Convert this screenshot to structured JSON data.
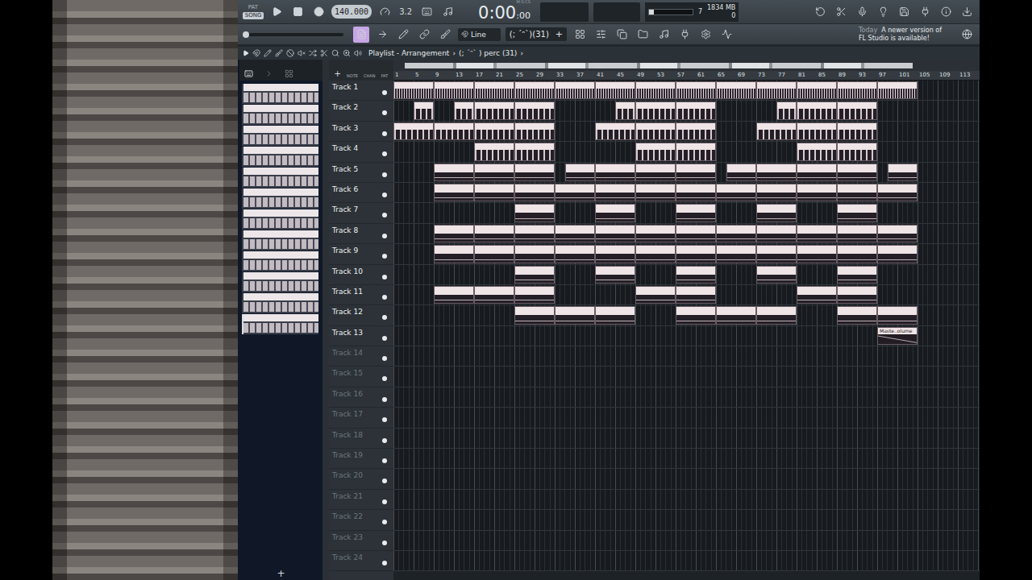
{
  "transport": {
    "modes": [
      {
        "label": "PAT",
        "selected": false
      },
      {
        "label": "SONG",
        "selected": true
      }
    ],
    "tempo": "140.000",
    "step": "3.2",
    "time": "0:00",
    "time_cs": ":00",
    "time_format": "M:S:CS"
  },
  "monitor": {
    "cpu": "7",
    "memory": "1834 MB",
    "polyphony": "0",
    "cpu_level": 0.12
  },
  "master_pitch": {
    "level": 0
  },
  "tools": [
    {
      "selected": true
    },
    {
      "selected": false
    },
    {
      "selected": false
    },
    {
      "selected": false
    },
    {
      "selected": false
    }
  ],
  "snap": "Line",
  "pattern_picker": {
    "label": "(; ´ᵔ`)(31)",
    "add": "+"
  },
  "hint": {
    "date": "Today",
    "line1": "A newer version of",
    "line2": "FL Studio is available!"
  },
  "browser": {
    "patterns": [
      {
        "selected": false
      },
      {
        "selected": false
      },
      {
        "selected": false
      },
      {
        "selected": false
      },
      {
        "selected": false
      },
      {
        "selected": false
      },
      {
        "selected": false
      },
      {
        "selected": false
      },
      {
        "selected": false
      },
      {
        "selected": false
      },
      {
        "selected": false
      },
      {
        "selected": true
      }
    ],
    "add": "+"
  },
  "playlist": {
    "title": "Playlist - Arrangement",
    "separator": "›",
    "pattern": "(; ´ᵔ` ) perc (31)",
    "header_tabs": [
      "NOTE",
      "CHAN",
      "PAT"
    ],
    "add": "+",
    "ruler": [
      "1",
      "5",
      "9",
      "13",
      "17",
      "21",
      "25",
      "29",
      "33",
      "37",
      "41",
      "45",
      "49",
      "53",
      "57",
      "61",
      "65",
      "69",
      "73",
      "77",
      "81",
      "85",
      "89",
      "93",
      "97",
      "101",
      "105",
      "109",
      "113"
    ],
    "tracks": [
      {
        "name": "Track 1",
        "dimmed": false,
        "kind": "dense",
        "clips": [
          {
            "start": 1,
            "length": 8
          },
          {
            "start": 9,
            "length": 8
          },
          {
            "start": 17,
            "length": 8
          },
          {
            "start": 25,
            "length": 8
          },
          {
            "start": 33,
            "length": 8
          },
          {
            "start": 41,
            "length": 8
          },
          {
            "start": 49,
            "length": 8
          },
          {
            "start": 57,
            "length": 8
          },
          {
            "start": 65,
            "length": 8
          },
          {
            "start": 73,
            "length": 8
          },
          {
            "start": 81,
            "length": 8
          },
          {
            "start": 89,
            "length": 8
          },
          {
            "start": 97,
            "length": 8
          }
        ]
      },
      {
        "name": "Track 2",
        "dimmed": false,
        "kind": "notes",
        "clips": [
          {
            "start": 5,
            "length": 4
          },
          {
            "start": 13,
            "length": 4
          },
          {
            "start": 17,
            "length": 8
          },
          {
            "start": 25,
            "length": 8
          },
          {
            "start": 45,
            "length": 4
          },
          {
            "start": 49,
            "length": 8
          },
          {
            "start": 57,
            "length": 8
          },
          {
            "start": 77,
            "length": 4
          },
          {
            "start": 81,
            "length": 8
          },
          {
            "start": 89,
            "length": 8
          }
        ]
      },
      {
        "name": "Track 3",
        "dimmed": false,
        "kind": "notes",
        "clips": [
          {
            "start": 1,
            "length": 8
          },
          {
            "start": 9,
            "length": 8
          },
          {
            "start": 17,
            "length": 8
          },
          {
            "start": 25,
            "length": 8
          },
          {
            "start": 41,
            "length": 8
          },
          {
            "start": 49,
            "length": 8
          },
          {
            "start": 57,
            "length": 8
          },
          {
            "start": 73,
            "length": 8
          },
          {
            "start": 81,
            "length": 8
          },
          {
            "start": 89,
            "length": 8
          }
        ]
      },
      {
        "name": "Track 4",
        "dimmed": false,
        "kind": "notes",
        "clips": [
          {
            "start": 17,
            "length": 8
          },
          {
            "start": 25,
            "length": 8
          },
          {
            "start": 49,
            "length": 8
          },
          {
            "start": 57,
            "length": 8
          },
          {
            "start": 81,
            "length": 8
          },
          {
            "start": 89,
            "length": 8
          }
        ]
      },
      {
        "name": "Track 5",
        "dimmed": false,
        "kind": "bar",
        "clips": [
          {
            "start": 9,
            "length": 8
          },
          {
            "start": 17,
            "length": 8
          },
          {
            "start": 25,
            "length": 8
          },
          {
            "start": 35,
            "length": 6
          },
          {
            "start": 41,
            "length": 8
          },
          {
            "start": 49,
            "length": 8
          },
          {
            "start": 57,
            "length": 8
          },
          {
            "start": 67,
            "length": 6
          },
          {
            "start": 73,
            "length": 8
          },
          {
            "start": 81,
            "length": 8
          },
          {
            "start": 89,
            "length": 8
          },
          {
            "start": 99,
            "length": 6
          }
        ]
      },
      {
        "name": "Track 6",
        "dimmed": false,
        "kind": "bar",
        "clips": [
          {
            "start": 9,
            "length": 8
          },
          {
            "start": 17,
            "length": 8
          },
          {
            "start": 25,
            "length": 8
          },
          {
            "start": 33,
            "length": 8
          },
          {
            "start": 41,
            "length": 8
          },
          {
            "start": 49,
            "length": 8
          },
          {
            "start": 57,
            "length": 8
          },
          {
            "start": 65,
            "length": 8
          },
          {
            "start": 73,
            "length": 8
          },
          {
            "start": 81,
            "length": 8
          },
          {
            "start": 89,
            "length": 8
          },
          {
            "start": 97,
            "length": 8
          }
        ]
      },
      {
        "name": "Track 7",
        "dimmed": false,
        "kind": "bar",
        "clips": [
          {
            "start": 25,
            "length": 8
          },
          {
            "start": 41,
            "length": 8
          },
          {
            "start": 57,
            "length": 8
          },
          {
            "start": 73,
            "length": 8
          },
          {
            "start": 89,
            "length": 8
          }
        ]
      },
      {
        "name": "Track 8",
        "dimmed": false,
        "kind": "bar",
        "clips": [
          {
            "start": 9,
            "length": 8
          },
          {
            "start": 17,
            "length": 8
          },
          {
            "start": 25,
            "length": 8
          },
          {
            "start": 33,
            "length": 8
          },
          {
            "start": 41,
            "length": 8
          },
          {
            "start": 49,
            "length": 8
          },
          {
            "start": 57,
            "length": 8
          },
          {
            "start": 65,
            "length": 8
          },
          {
            "start": 73,
            "length": 8
          },
          {
            "start": 81,
            "length": 8
          },
          {
            "start": 89,
            "length": 8
          },
          {
            "start": 97,
            "length": 8
          }
        ]
      },
      {
        "name": "Track 9",
        "dimmed": false,
        "kind": "bar",
        "clips": [
          {
            "start": 9,
            "length": 8
          },
          {
            "start": 17,
            "length": 8
          },
          {
            "start": 25,
            "length": 8
          },
          {
            "start": 33,
            "length": 8
          },
          {
            "start": 41,
            "length": 8
          },
          {
            "start": 49,
            "length": 8
          },
          {
            "start": 57,
            "length": 8
          },
          {
            "start": 65,
            "length": 8
          },
          {
            "start": 73,
            "length": 8
          },
          {
            "start": 81,
            "length": 8
          },
          {
            "start": 89,
            "length": 8
          },
          {
            "start": 97,
            "length": 8
          }
        ]
      },
      {
        "name": "Track 10",
        "dimmed": false,
        "kind": "bar",
        "clips": [
          {
            "start": 25,
            "length": 8
          },
          {
            "start": 41,
            "length": 8
          },
          {
            "start": 57,
            "length": 8
          },
          {
            "start": 73,
            "length": 8
          },
          {
            "start": 89,
            "length": 8
          }
        ]
      },
      {
        "name": "Track 11",
        "dimmed": false,
        "kind": "bar",
        "clips": [
          {
            "start": 9,
            "length": 8
          },
          {
            "start": 17,
            "length": 8
          },
          {
            "start": 25,
            "length": 8
          },
          {
            "start": 49,
            "length": 8
          },
          {
            "start": 57,
            "length": 8
          },
          {
            "start": 81,
            "length": 8
          },
          {
            "start": 89,
            "length": 8
          }
        ]
      },
      {
        "name": "Track 12",
        "dimmed": false,
        "kind": "bar",
        "clips": [
          {
            "start": 25,
            "length": 8
          },
          {
            "start": 33,
            "length": 8
          },
          {
            "start": 41,
            "length": 8
          },
          {
            "start": 57,
            "length": 8
          },
          {
            "start": 65,
            "length": 8
          },
          {
            "start": 73,
            "length": 8
          },
          {
            "start": 89,
            "length": 8
          },
          {
            "start": 97,
            "length": 8
          }
        ]
      },
      {
        "name": "Track 13",
        "dimmed": false,
        "kind": "automation",
        "clips": [
          {
            "start": 97,
            "length": 8,
            "label": "Maste..olume"
          }
        ]
      },
      {
        "name": "Track 14",
        "dimmed": true,
        "kind": "bar",
        "clips": []
      },
      {
        "name": "Track 15",
        "dimmed": true,
        "kind": "bar",
        "clips": []
      },
      {
        "name": "Track 16",
        "dimmed": true,
        "kind": "bar",
        "clips": []
      },
      {
        "name": "Track 17",
        "dimmed": true,
        "kind": "bar",
        "clips": []
      },
      {
        "name": "Track 18",
        "dimmed": true,
        "kind": "bar",
        "clips": []
      },
      {
        "name": "Track 19",
        "dimmed": true,
        "kind": "bar",
        "clips": []
      },
      {
        "name": "Track 20",
        "dimmed": true,
        "kind": "bar",
        "clips": []
      },
      {
        "name": "Track 21",
        "dimmed": true,
        "kind": "bar",
        "clips": []
      },
      {
        "name": "Track 22",
        "dimmed": true,
        "kind": "bar",
        "clips": []
      },
      {
        "name": "Track 23",
        "dimmed": true,
        "kind": "bar",
        "clips": []
      },
      {
        "name": "Track 24",
        "dimmed": true,
        "kind": "bar",
        "clips": []
      }
    ]
  }
}
